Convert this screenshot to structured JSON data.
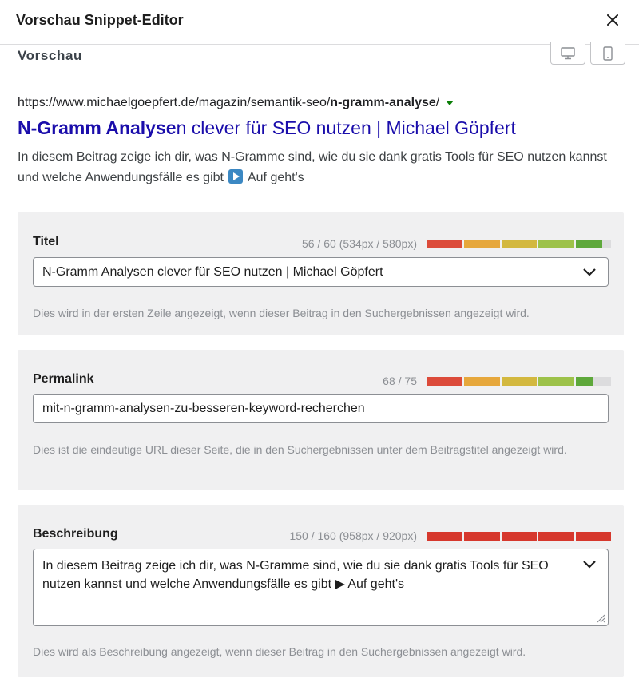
{
  "header": {
    "title": "Vorschau Snippet-Editor",
    "close_icon": "close-icon"
  },
  "preview": {
    "label": "Vorschau",
    "devices": [
      {
        "name": "desktop-preview",
        "icon": "desktop-icon"
      },
      {
        "name": "mobile-preview",
        "icon": "mobile-icon"
      }
    ]
  },
  "serp": {
    "url_prefix": "https://www.michaelgoepfert.de/magazin/semantik-seo/",
    "url_bold": "n-gramm-analyse",
    "url_suffix": "/",
    "title_bold": "N-Gramm Analyse",
    "title_rest": "n clever für SEO nutzen | Michael Göpfert",
    "desc_main": "In diesem Beitrag zeige ich dir, was N-Gramme sind, wie du sie dank gratis Tools für SEO nutzen kannst und welche Anwendungsfälle es gibt",
    "desc_tail": "Auf geht's"
  },
  "title_panel": {
    "label": "Titel",
    "count": "56 / 60 (534px / 580px)",
    "progress": 0.95,
    "value": "N-Gramm Analysen clever für SEO nutzen | Michael Göpfert",
    "help": "Dies wird in der ersten Zeile angezeigt, wenn dieser Beitrag in den Suchergebnissen angezeigt wird."
  },
  "permalink_panel": {
    "label": "Permalink",
    "count": "68 / 75",
    "progress": 0.9,
    "value": "mit-n-gramm-analysen-zu-besseren-keyword-recherchen",
    "help": "Dies ist die eindeutige URL dieser Seite, die in den Suchergebnissen unter dem Beitragstitel angezeigt wird."
  },
  "description_panel": {
    "label": "Beschreibung",
    "count": "150 / 160 (958px / 920px)",
    "progress": 1.0,
    "value": "In diesem Beitrag zeige ich dir, was N-Gramme sind, wie du sie dank gratis Tools für SEO nutzen kannst und welche Anwendungsfälle es gibt ▶ Auf geht's",
    "help": "Dies wird als Beschreibung angezeigt, wenn dieser Beitrag in den Suchergebnissen angezeigt wird."
  },
  "colors": {
    "scale": [
      "#dc4b3a",
      "#e0773a",
      "#e6a73c",
      "#d3b83f",
      "#9dc24a",
      "#5ea83b"
    ],
    "over_limit": "#d6382d",
    "link": "#1a0dab"
  }
}
